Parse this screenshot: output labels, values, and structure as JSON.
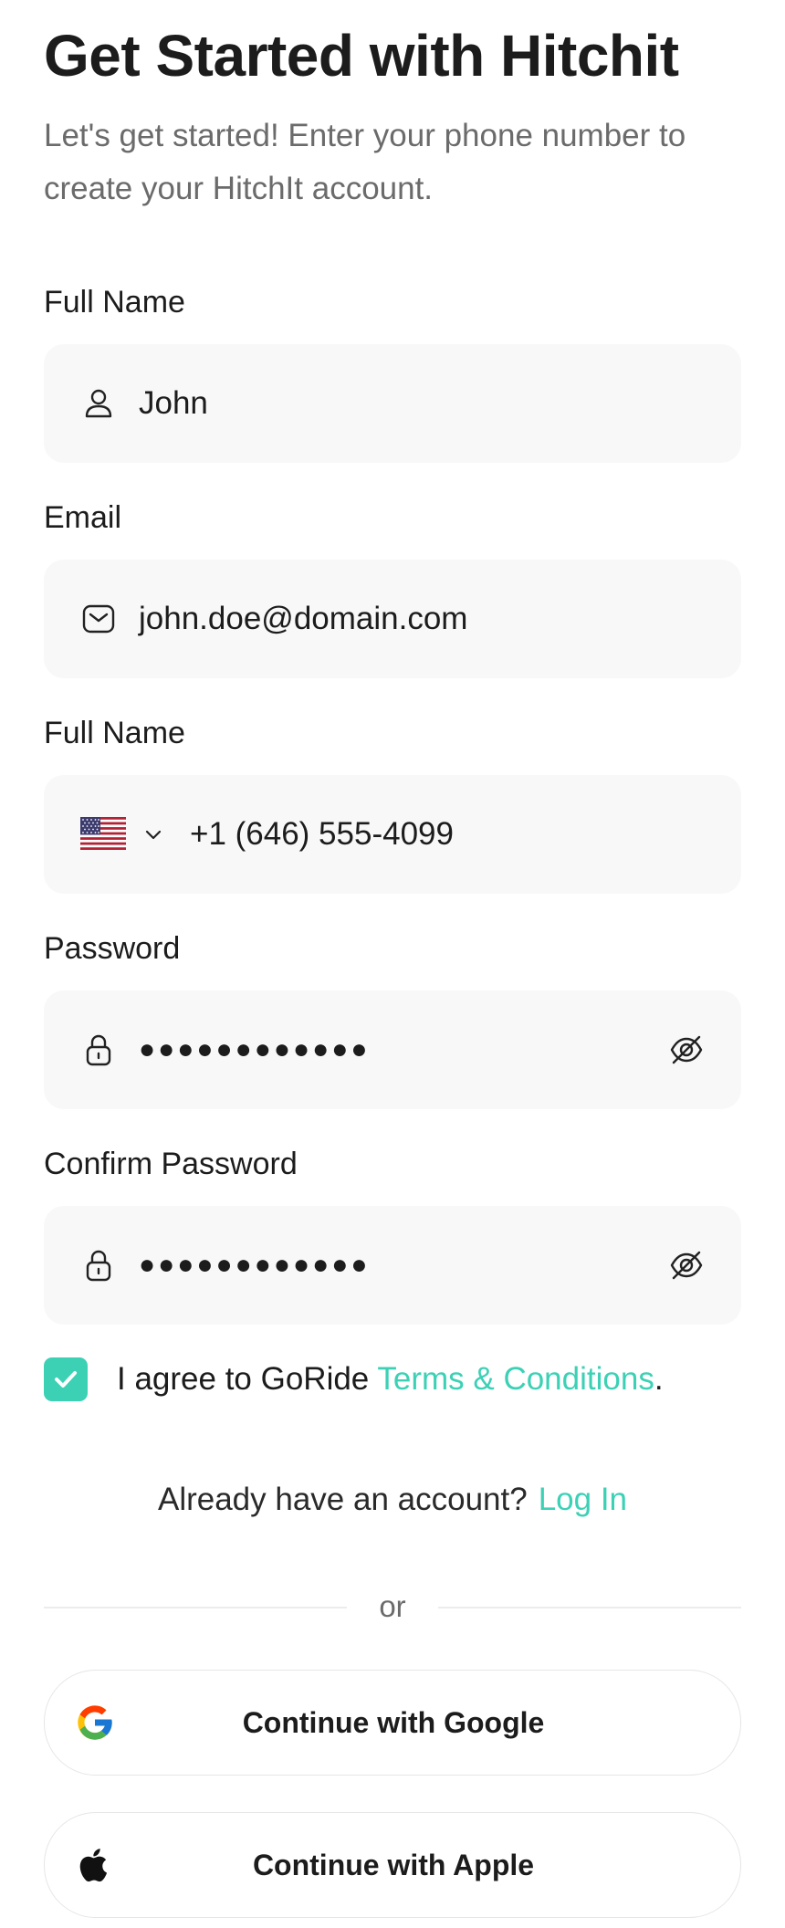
{
  "header": {
    "title": "Get Started with Hitchit",
    "subtitle": "Let's get started! Enter your phone number to create your HitchIt account."
  },
  "form": {
    "full_name": {
      "label": "Full Name",
      "value": "John",
      "icon": "user-icon"
    },
    "email": {
      "label": "Email",
      "value": "john.doe@domain.com",
      "icon": "mail-icon"
    },
    "phone": {
      "label": "Full Name",
      "country": "United States",
      "flag_icon": "us-flag-icon",
      "value": "+1 (646) 555-4099"
    },
    "password": {
      "label": "Password",
      "value": "●●●●●●●●●●●●",
      "icon": "lock-icon",
      "toggle_icon": "eye-off-icon"
    },
    "confirm_password": {
      "label": "Confirm Password",
      "value": "●●●●●●●●●●●●",
      "icon": "lock-icon",
      "toggle_icon": "eye-off-icon"
    }
  },
  "agreement": {
    "checked": true,
    "text_prefix": "I agree to GoRide ",
    "link_text": "Terms & Conditions",
    "text_suffix": "."
  },
  "login_prompt": {
    "text": "Already have an account?",
    "link_text": "Log In"
  },
  "divider": {
    "text": "or"
  },
  "social": {
    "google_label": "Continue with Google",
    "apple_label": "Continue with Apple"
  },
  "colors": {
    "accent": "#3cd1b5",
    "field_bg": "#f8f8f8",
    "text_primary": "#1c1c1c",
    "text_secondary": "#6b6b6b"
  }
}
